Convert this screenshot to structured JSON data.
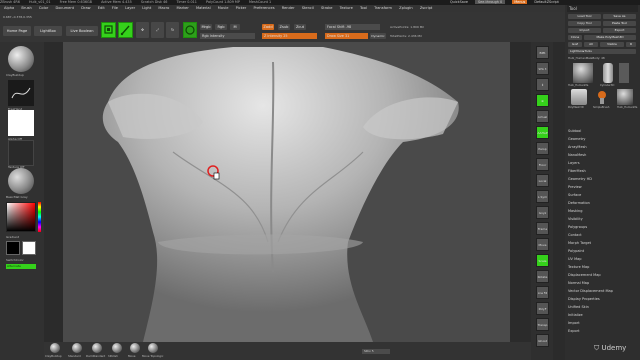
{
  "topbar": {
    "items": [
      "ZBrush 4R6",
      "Hulk_v01_01",
      "Free Mem 0.636GB",
      "Active Mem 4.435",
      "Scratch Disk 46",
      "Timer 0.011",
      "PolyCount 1.809 MP",
      "MeshCount 1"
    ],
    "right": [
      "QuickSave",
      "See-through 0",
      "Menus",
      "DefaultZScript"
    ]
  },
  "menubar": {
    "items": [
      "Alpha",
      "Brush",
      "Color",
      "Document",
      "Draw",
      "Edit",
      "File",
      "Layer",
      "Light",
      "Macro",
      "Marker",
      "Material",
      "Movie",
      "Picker",
      "Preferences",
      "Render",
      "Stencil",
      "Stroke",
      "Texture",
      "Tool",
      "Transform",
      "Zplugin",
      "Zscript"
    ]
  },
  "coords": "0.687,-0.378,0.355",
  "shelf": {
    "home_page": "Home Page",
    "lightbox": "LightBox",
    "live_boolean": "Live Boolean",
    "edit": "Edit",
    "draw": "Draw",
    "move": "Move",
    "scale": "Scale",
    "rotate": "Rotate",
    "mrgb": "Mrgb",
    "rgb": "Rgb",
    "m": "M",
    "rgb_intensity": "Rgb Intensity",
    "zadd": "Zadd",
    "zsub": "Zsub",
    "zcut": "Zcut",
    "z_intensity": "Z Intensity 25",
    "focal_shift": "Focal Shift -98",
    "draw_size": "Draw Size 31",
    "dynamic": "Dynamic",
    "active_points": "ActivePoints: 1.809 Mil",
    "total_points": "TotalPoints: 2.436 Mil"
  },
  "left": {
    "brush": "ClayBuildup",
    "stroke": "FreeHand",
    "alpha": "Alpha Off",
    "texture": "Texture Off",
    "material": "BasicMat Gray",
    "gradient": "Gradient",
    "switch_color": "SwitchColor",
    "alternate": "Alternate"
  },
  "right_strip": [
    "BPR",
    "SPix 3",
    "Scroll",
    "Zoom",
    "Actual",
    "AAHalf",
    "Persp",
    "Floor",
    "Local",
    "L.Sym",
    "Gxyz",
    "Frame",
    "Move",
    "Scale",
    "Rotate",
    "Line Fill",
    "PolyF",
    "Transp",
    "Ghost",
    "Solo",
    "Xpose"
  ],
  "tool_panel": {
    "title": "Tool",
    "buttons": [
      "Load Tool",
      "Save As",
      "Copy Tool",
      "Paste Tool",
      "Import",
      "Export",
      "Clone",
      "Make PolyMesh3D",
      "GoZ",
      "All",
      "Visible",
      "R"
    ],
    "lightbox_tools": "Lightbox▸Tools",
    "current": "Hulk_HumanMaleBody: 48",
    "thumbs": [
      "Hulk_HumanMa",
      "Cylinder3D",
      "PolyMesh3D",
      "SimpleBrush",
      "Hulk_HumanMa"
    ],
    "menu": [
      "Subtool",
      "Geometry",
      "ArrayMesh",
      "NanoMesh",
      "Layers",
      "FiberMesh",
      "Geometry HD",
      "Preview",
      "Surface",
      "Deformation",
      "Masking",
      "Visibility",
      "Polygroups",
      "Contact",
      "Morph Target",
      "Polypaint",
      "UV Map",
      "Texture Map",
      "Displacement Map",
      "Normal Map",
      "Vector Displacement Map",
      "Display Properties",
      "Unified Skin",
      "Initialize",
      "Import",
      "Export"
    ]
  },
  "bottom": {
    "brushes": [
      "ClayBuildup",
      "Standard",
      "DamStandard",
      "hPolish",
      "Move",
      "Move Topologic"
    ],
    "sdiv": "SDiv 5"
  },
  "watermark": "Udemy",
  "colors": {
    "accent_green": "#35d11b",
    "accent_orange": "#d86b1b",
    "cursor_red": "#e02020"
  }
}
